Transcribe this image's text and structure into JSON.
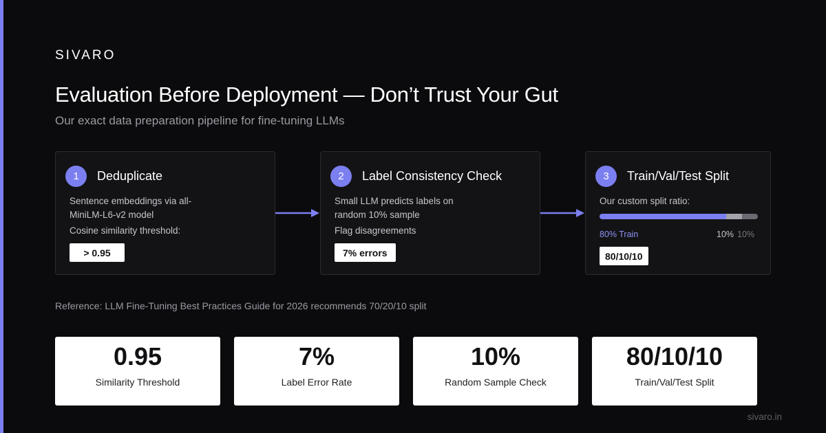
{
  "brand": "SIVARO",
  "title": "Evaluation Before Deployment — Don’t Trust Your Gut",
  "subtitle": "Our exact data preparation pipeline for fine-tuning LLMs",
  "colors": {
    "accent": "#7c7ff0",
    "background": "#0b0b0d",
    "card": "#131316",
    "muted": "#9a9aa3"
  },
  "steps": [
    {
      "number": "1",
      "title": "Deduplicate",
      "body": "Sentence embeddings via all-MiniLM-L6-v2 model",
      "note": "Cosine similarity threshold:",
      "chip": "> 0.95"
    },
    {
      "number": "2",
      "title": "Label Consistency Check",
      "body": "Small LLM predicts labels on random 10% sample",
      "note": "Flag disagreements",
      "chip": "7% errors"
    },
    {
      "number": "3",
      "title": "Train/Val/Test Split",
      "note": "Our custom split ratio:",
      "split": [
        {
          "label": "80% Train",
          "percent": 80
        },
        {
          "label": "10%",
          "percent": 10
        },
        {
          "label": "10%",
          "percent": 10
        }
      ],
      "chip": "80/10/10"
    }
  ],
  "reference": "Reference: LLM Fine-Tuning Best Practices Guide for 2026 recommends 70/20/10 split",
  "stats": [
    {
      "value": "0.95",
      "label": "Similarity Threshold"
    },
    {
      "value": "7%",
      "label": "Label Error Rate"
    },
    {
      "value": "10%",
      "label": "Random Sample Check"
    },
    {
      "value": "80/10/10",
      "label": "Train/Val/Test Split"
    }
  ],
  "footer": "sivaro.in"
}
